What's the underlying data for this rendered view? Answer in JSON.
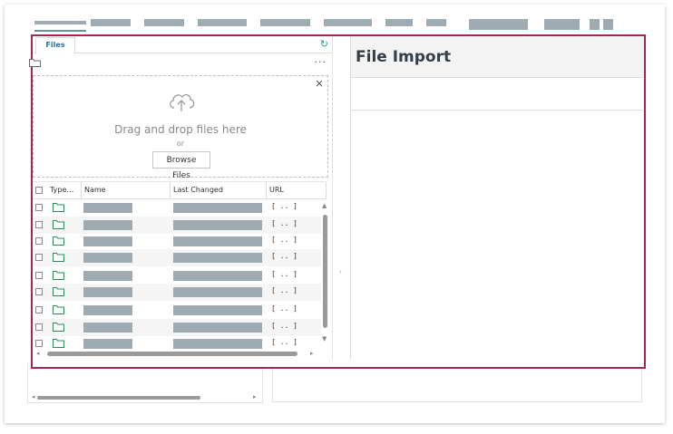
{
  "topbar": {
    "tabs": [
      "",
      "",
      "",
      "",
      "",
      "",
      "",
      ""
    ]
  },
  "files_panel": {
    "tab_label": "Files",
    "refresh_icon": "refresh-icon",
    "more_label": "···"
  },
  "dropzone": {
    "close_label": "×",
    "message": "Drag and drop files here",
    "or_label": "or",
    "browse_label": "Browse Files"
  },
  "grid": {
    "columns": [
      "Type…",
      "Name",
      "Last Changed",
      "URL"
    ],
    "url_label": "[ .. ]",
    "row_count": 9
  },
  "import_panel": {
    "title": "File Import"
  },
  "colors": {
    "accent": "#a1284f",
    "tab_text": "#2a6fa3",
    "folder": "#2e8b57",
    "redacted": "#9eabb3"
  }
}
